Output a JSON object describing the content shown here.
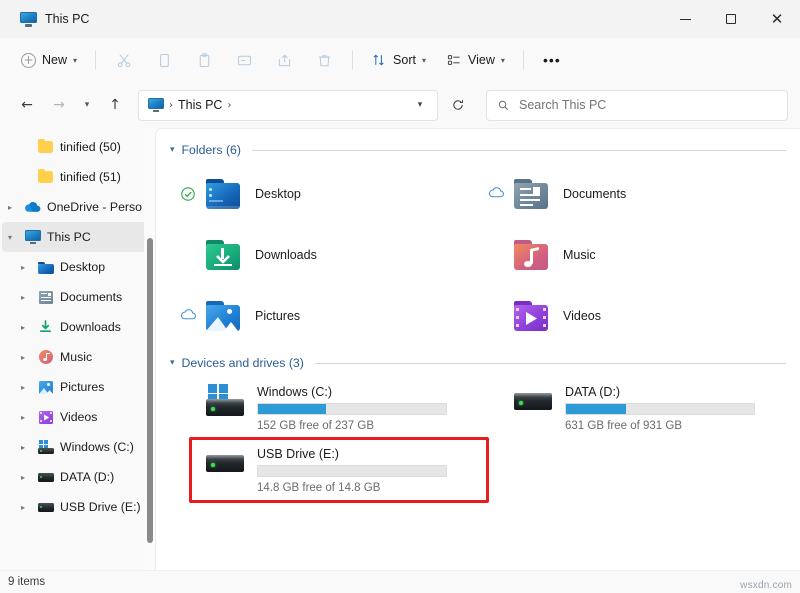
{
  "window": {
    "tab_title": "This PC",
    "tab_icon": "this-pc-icon",
    "controls": {
      "minimize": "–",
      "maximize": "□",
      "close": "✕"
    }
  },
  "toolbar": {
    "new_label": "New",
    "new_icon": "plus-circle-icon",
    "cut_icon": "scissors-icon",
    "copy_icon": "copy-icon",
    "paste_icon": "clipboard-paste-icon",
    "rename_icon": "rename-icon",
    "share_icon": "share-icon",
    "delete_icon": "trash-icon",
    "sort_label": "Sort",
    "sort_icon": "sort-arrows-icon",
    "view_label": "View",
    "view_icon": "view-list-icon",
    "more_label": "•••",
    "chevron": "⌄"
  },
  "address": {
    "back_icon": "arrow-left-icon",
    "forward_icon": "arrow-right-icon",
    "recent_icon": "chevron-down-icon",
    "up_icon": "arrow-up-icon",
    "crumb_icon": "this-pc-icon",
    "crumb_text": "This PC",
    "separator": "›",
    "dropdown_icon": "chevron-down-icon",
    "refresh_icon": "refresh-icon"
  },
  "search": {
    "icon": "search-icon",
    "placeholder": "Search This PC",
    "value": ""
  },
  "sidebar": {
    "items": [
      {
        "label": "tinified (50)",
        "icon": "folder-icon",
        "indent": 2,
        "expandable": false,
        "selected": false
      },
      {
        "label": "tinified (51)",
        "icon": "folder-icon",
        "indent": 2,
        "expandable": false,
        "selected": false
      },
      {
        "label": "OneDrive - Perso",
        "icon": "onedrive-cloud-icon",
        "indent": 1,
        "expandable": true,
        "selected": false
      },
      {
        "label": "This PC",
        "icon": "this-pc-icon",
        "indent": 1,
        "expandable": true,
        "expanded": true,
        "selected": true
      },
      {
        "label": "Desktop",
        "icon": "desktop-folder-icon",
        "indent": 2,
        "expandable": true,
        "selected": false
      },
      {
        "label": "Documents",
        "icon": "documents-folder-icon",
        "indent": 2,
        "expandable": true,
        "selected": false
      },
      {
        "label": "Downloads",
        "icon": "downloads-folder-icon",
        "indent": 2,
        "expandable": true,
        "selected": false
      },
      {
        "label": "Music",
        "icon": "music-folder-icon",
        "indent": 2,
        "expandable": true,
        "selected": false
      },
      {
        "label": "Pictures",
        "icon": "pictures-folder-icon",
        "indent": 2,
        "expandable": true,
        "selected": false
      },
      {
        "label": "Videos",
        "icon": "videos-folder-icon",
        "indent": 2,
        "expandable": true,
        "selected": false
      },
      {
        "label": "Windows (C:)",
        "icon": "windows-drive-icon",
        "indent": 2,
        "expandable": true,
        "selected": false
      },
      {
        "label": "DATA (D:)",
        "icon": "drive-icon",
        "indent": 2,
        "expandable": true,
        "selected": false
      },
      {
        "label": "USB Drive (E:)",
        "icon": "drive-icon",
        "indent": 2,
        "expandable": true,
        "selected": false
      }
    ]
  },
  "main": {
    "folders_group": {
      "title": "Folders (6)",
      "chevron": "⌄",
      "items": [
        {
          "label": "Desktop",
          "icon": "desktop-folder-icon",
          "sync": "synced-check-icon"
        },
        {
          "label": "Documents",
          "icon": "documents-folder-icon",
          "sync": "cloud-online-icon"
        },
        {
          "label": "Downloads",
          "icon": "downloads-folder-icon",
          "sync": ""
        },
        {
          "label": "Music",
          "icon": "music-folder-icon",
          "sync": ""
        },
        {
          "label": "Pictures",
          "icon": "pictures-folder-icon",
          "sync": "cloud-online-icon"
        },
        {
          "label": "Videos",
          "icon": "videos-folder-icon",
          "sync": ""
        }
      ]
    },
    "drives_group": {
      "title": "Devices and drives (3)",
      "chevron": "⌄",
      "items": [
        {
          "name": "Windows (C:)",
          "icon": "windows-drive-icon",
          "free_text": "152 GB free of 237 GB",
          "used_percent": 36,
          "highlighted": false
        },
        {
          "name": "DATA (D:)",
          "icon": "drive-icon",
          "free_text": "631 GB free of 931 GB",
          "used_percent": 32,
          "highlighted": false
        },
        {
          "name": "USB Drive (E:)",
          "icon": "drive-icon",
          "free_text": "14.8 GB free of 14.8 GB",
          "used_percent": 0,
          "highlighted": true
        }
      ]
    }
  },
  "status": {
    "item_count": "9 items"
  },
  "watermark": "wsxdn.com",
  "colors": {
    "accent_blue": "#2e9bd6",
    "group_header_blue": "#2a5b96",
    "highlight_red": "#e81c1c",
    "selected_nav": "#e8e8e8",
    "content_bg": "#ffffff",
    "chrome_bg": "#f9f9f9"
  }
}
